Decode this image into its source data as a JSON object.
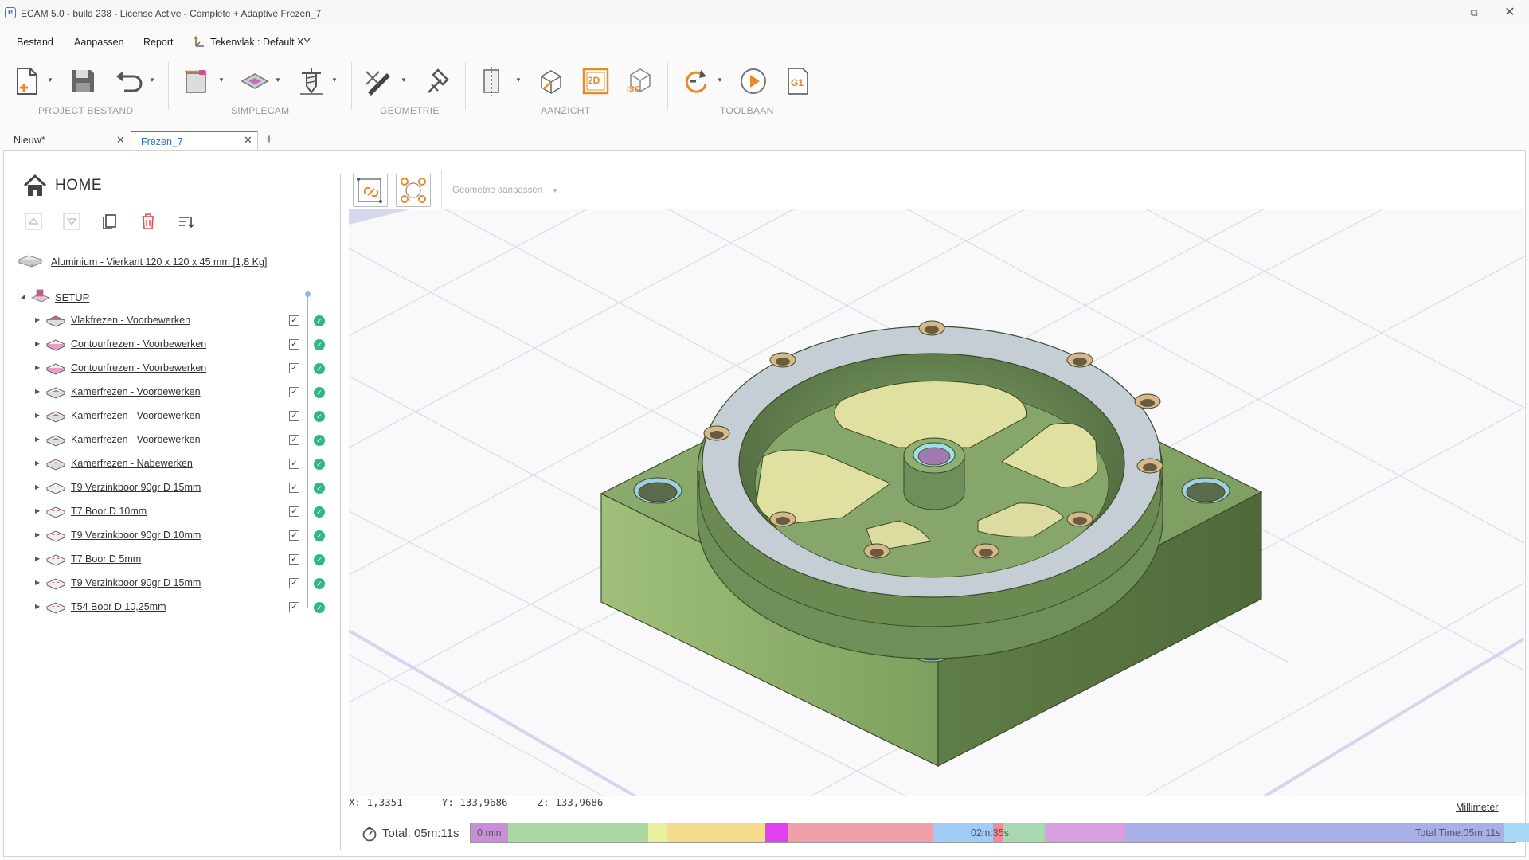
{
  "window": {
    "title": "ECAM 5.0 - build 238 - License Active -  Complete + Adaptive Frezen_7",
    "app_icon_letter": "e"
  },
  "menu": {
    "items": [
      "Bestand",
      "Aanpassen",
      "Report"
    ],
    "workplane": "Tekenvlak : Default XY"
  },
  "ribbon": {
    "groups": [
      "PROJECT BESTAND",
      "SIMPLECAM",
      "GEOMETRIE",
      "AANZICHT",
      "TOOLBAAN"
    ],
    "view_2d_label": "2D",
    "view_iso_label": "ISO",
    "gcode_label": "G1"
  },
  "tabs": [
    {
      "label": "Nieuw*",
      "active": false
    },
    {
      "label": "Frezen_7",
      "active": true
    }
  ],
  "tab_add": "+",
  "tree": {
    "home_label": "HOME",
    "material": "Aluminium - Vierkant 120 x 120 x 45 mm [1,8 Kg]",
    "setup_label": "SETUP",
    "operations": [
      {
        "label": "Vlakfrezen - Voorbewerken",
        "icon": "face-mill-icon"
      },
      {
        "label": "Contourfrezen - Voorbewerken",
        "icon": "contour-mill-icon"
      },
      {
        "label": "Contourfrezen - Voorbewerken",
        "icon": "contour-mill-icon"
      },
      {
        "label": "Kamerfrezen - Voorbewerken",
        "icon": "pocket-mill-icon"
      },
      {
        "label": "Kamerfrezen - Voorbewerken",
        "icon": "pocket-mill-icon"
      },
      {
        "label": "Kamerfrezen - Voorbewerken",
        "icon": "pocket-mill-icon"
      },
      {
        "label": "Kamerfrezen - Nabewerken",
        "icon": "pocket-mill-icon"
      },
      {
        "label": "T9 Verzinkboor 90gr D 15mm",
        "icon": "drill-icon"
      },
      {
        "label": "T7 Boor D 10mm",
        "icon": "drill-icon"
      },
      {
        "label": "T9 Verzinkboor 90gr D 10mm",
        "icon": "drill-icon"
      },
      {
        "label": "T7 Boor D 5mm",
        "icon": "drill-icon"
      },
      {
        "label": "T9 Verzinkboor 90gr D 15mm",
        "icon": "drill-icon"
      },
      {
        "label": "T54 Boor D 10,25mm",
        "icon": "drill-icon"
      }
    ]
  },
  "viewport": {
    "geometry_dropdown": "Geometrie aanpassen",
    "coords": {
      "x": "X:-1,3351",
      "y": "Y:-133,9686",
      "z": "Z:-133,9686"
    },
    "units": "Millimeter"
  },
  "timeline": {
    "total_label": "Total: 05m:11s",
    "start_label": "0 min",
    "mid_label": "02m:35s",
    "end_label": "Total Time:05m:11s",
    "segments": [
      {
        "color": "#c88fd8",
        "fraction": 0.036
      },
      {
        "color": "#a9d8a0",
        "fraction": 0.134
      },
      {
        "color": "#e8f0a0",
        "fraction": 0.018
      },
      {
        "color": "#f5dc8a",
        "fraction": 0.094
      },
      {
        "color": "#e040f0",
        "fraction": 0.021
      },
      {
        "color": "#f0a0a8",
        "fraction": 0.139
      },
      {
        "color": "#a0cdf5",
        "fraction": 0.058
      },
      {
        "color": "#f08a98",
        "fraction": 0.01
      },
      {
        "color": "#a8d8b0",
        "fraction": 0.04
      },
      {
        "color": "#d8a0e0",
        "fraction": 0.077
      },
      {
        "color": "#a8b0e8",
        "fraction": 0.363
      },
      {
        "color": "#a8d8f8",
        "fraction": 0.046
      },
      {
        "color": "#c8e8b0",
        "fraction": 0.06
      }
    ]
  },
  "colors": {
    "accent": "#2f7fd5",
    "toolpath_orange": "#e8892a",
    "part_green": "#8faf6a"
  }
}
